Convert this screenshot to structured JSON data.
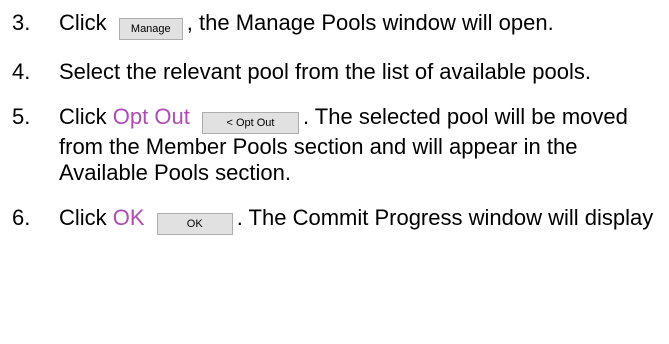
{
  "steps": [
    {
      "number": "3.",
      "before": "Click",
      "button_label": "Manage",
      "after": ", the Manage Pools window will open."
    },
    {
      "number": "4.",
      "text": "Select the relevant pool from the list of available pools."
    },
    {
      "number": "5.",
      "before": "Click",
      "highlight": "Opt Out",
      "button_label": "< Opt Out",
      "after": ". The selected pool will be moved from the Member Pools section and will appear in the Available Pools section."
    },
    {
      "number": "6.",
      "before": "Click",
      "highlight": "OK",
      "button_label": "OK",
      "after": ". The Commit Progress window will display"
    }
  ],
  "colors": {
    "highlight": "#b04ab8",
    "button_bg": "#e1e1e1",
    "button_border": "#adadad"
  }
}
